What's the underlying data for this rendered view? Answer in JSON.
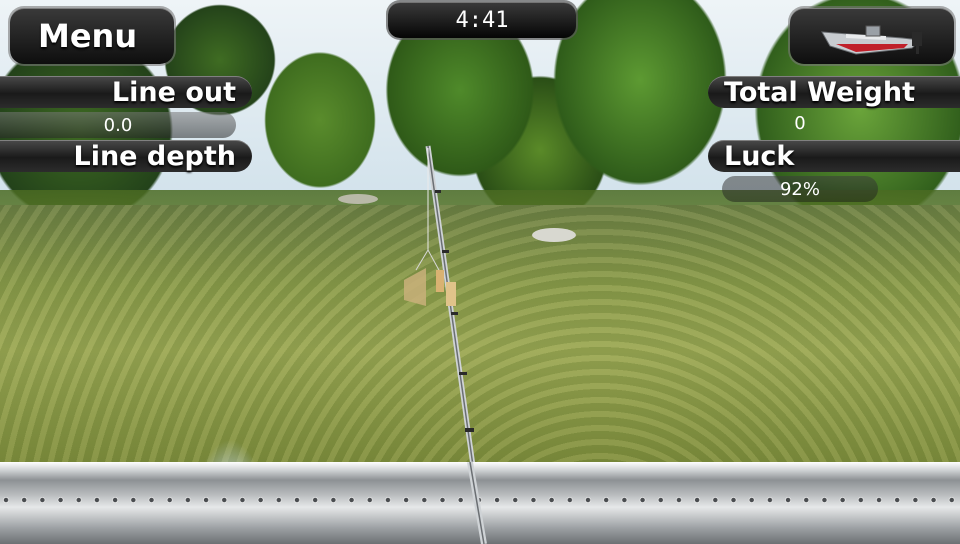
{
  "hud": {
    "menu_label": "Menu",
    "timer": "4:41",
    "line_out_label": "Line out",
    "line_out_value": "0.0",
    "line_depth_label": "Line depth",
    "total_weight_label": "Total Weight",
    "total_weight_value": "0",
    "luck_label": "Luck",
    "luck_value": "92%"
  },
  "icons": {
    "boat": "boat-icon"
  },
  "colors": {
    "hud_background": "#1a1a1a",
    "hud_text": "#ffffff",
    "boat_hull": "#c8ccd0",
    "boat_stripe": "#c0202a"
  }
}
